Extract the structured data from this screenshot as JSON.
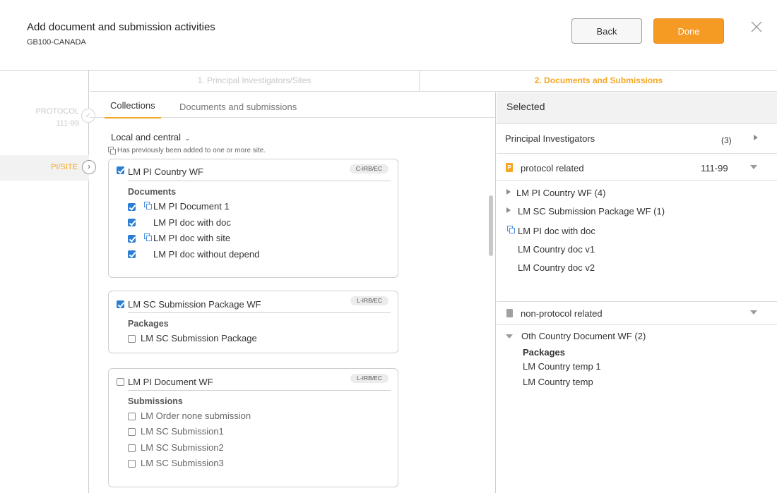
{
  "header": {
    "title": "Add document and submission activities",
    "subtitle": "GB100-CANADA",
    "back_label": "Back",
    "done_label": "Done"
  },
  "leftnav": {
    "protocol_label": "PROTOCOL",
    "protocol_value": "111-99",
    "pisite_label": "PI/SITE"
  },
  "steps": {
    "step1_num": "1.",
    "step1_label": "Principal Investigators/Sites",
    "step2_num": "2.",
    "step2_label": "Documents and Submissions"
  },
  "tabs": {
    "collections": "Collections",
    "documents": "Documents and submissions"
  },
  "filter": {
    "label": "Local and central",
    "legend": "Has previously been added to one or more site."
  },
  "cards": [
    {
      "title": "LM PI Country WF",
      "badge": "C-IRB/EC",
      "checked": true,
      "section": "Documents",
      "items": [
        {
          "label": "LM PI Document 1",
          "checked": true,
          "dupe": true
        },
        {
          "label": "LM PI doc with doc",
          "checked": true,
          "dupe": false
        },
        {
          "label": "LM PI doc with site",
          "checked": true,
          "dupe": true
        },
        {
          "label": "LM PI doc without depend",
          "checked": true,
          "dupe": false
        }
      ]
    },
    {
      "title": "LM SC Submission Package WF",
      "badge": "L-IRB/EC",
      "checked": true,
      "section": "Packages",
      "items": [
        {
          "label": "LM SC Submission Package",
          "checked": false
        }
      ]
    },
    {
      "title": "LM PI Document WF",
      "badge": "L-IRB/EC",
      "checked": false,
      "section": "Submissions",
      "items": [
        {
          "label": "LM Order none submission",
          "checked": false
        },
        {
          "label": "LM SC Submission1",
          "checked": false
        },
        {
          "label": "LM SC Submission2",
          "checked": false
        },
        {
          "label": "LM SC Submission3",
          "checked": false
        }
      ]
    }
  ],
  "selected": {
    "title": "Selected",
    "pi_label": "Principal Investigators",
    "pi_count": "(3)",
    "protocol_label": "protocol related",
    "protocol_value": "111-99",
    "protocol_items": [
      "LM PI Country WF (4)",
      "LM SC Submission Package WF (1)",
      "LM PI doc with doc",
      "LM Country doc v1",
      "LM Country doc v2"
    ],
    "nonprotocol_label": "non-protocol related",
    "nonprotocol_group": "Oth Country Document WF (2)",
    "nonprotocol_section": "Packages",
    "nonprotocol_items": [
      "LM Country temp 1",
      "LM Country temp"
    ]
  },
  "colors": {
    "accent": "#f5a623",
    "checkbox": "#2a7fd4"
  }
}
